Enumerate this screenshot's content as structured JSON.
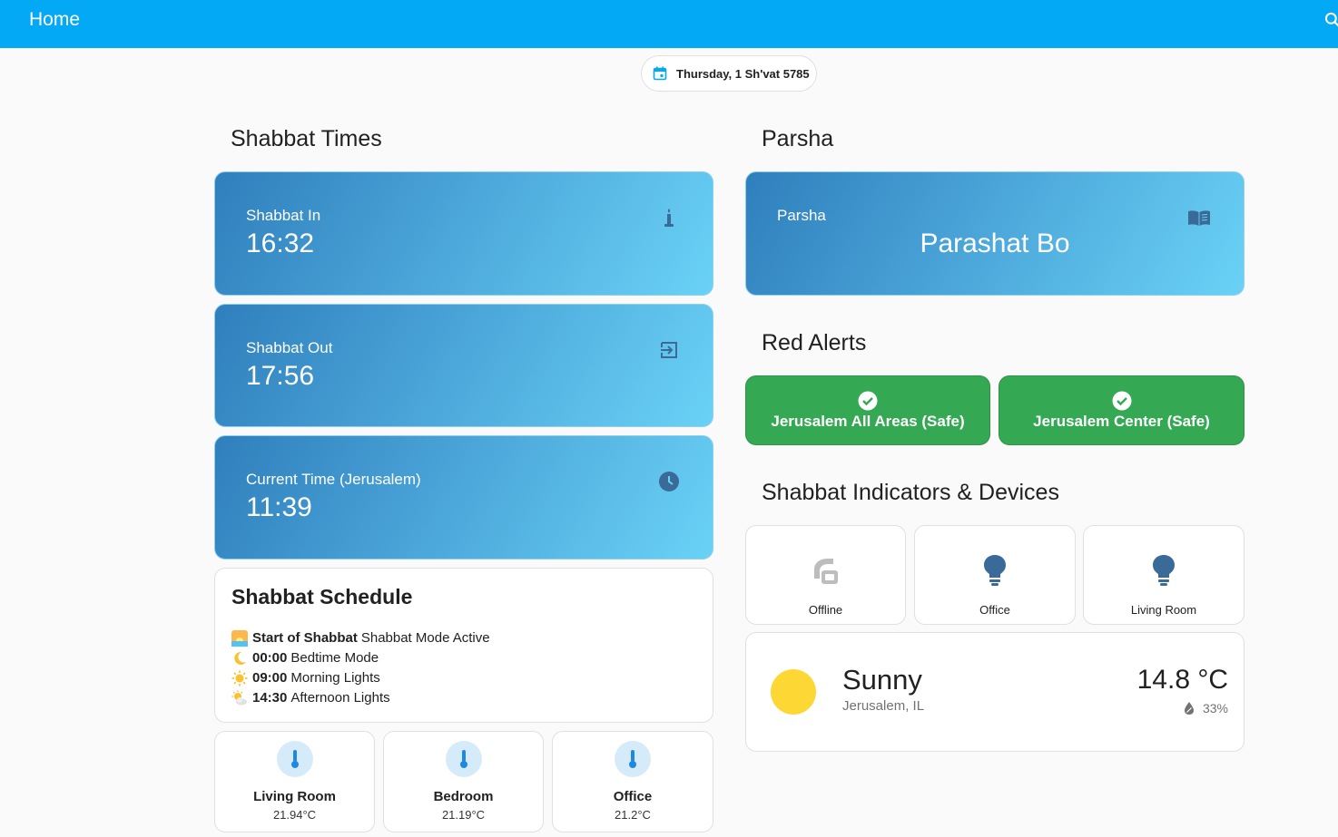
{
  "header": {
    "title": "Home",
    "search_icon": "search-icon"
  },
  "date_chip": {
    "icon": "calendar-icon",
    "text": "Thursday, 1 Sh'vat 5785"
  },
  "shabbat_times": {
    "title": "Shabbat Times",
    "cards": [
      {
        "label": "Shabbat In",
        "value": "16:32",
        "icon": "candle-icon"
      },
      {
        "label": "Shabbat Out",
        "value": "17:56",
        "icon": "exit-icon"
      },
      {
        "label": "Current Time (Jerusalem)",
        "value": "11:39",
        "icon": "clock-icon"
      }
    ]
  },
  "schedule": {
    "title": "Shabbat Schedule",
    "rows": [
      {
        "icon": "sunrise-icon",
        "time": "Start of Shabbat",
        "text": "Shabbat Mode Active"
      },
      {
        "icon": "moon-icon",
        "time": "00:00",
        "text": "Bedtime Mode"
      },
      {
        "icon": "sun-icon",
        "time": "09:00",
        "text": "Morning Lights"
      },
      {
        "icon": "sun-cloud-icon",
        "time": "14:30",
        "text": "Afternoon Lights"
      }
    ]
  },
  "temperatures": [
    {
      "name": "Living Room",
      "value": "21.94°C",
      "icon": "thermometer-icon"
    },
    {
      "name": "Bedroom",
      "value": "21.19°C",
      "icon": "thermometer-icon"
    },
    {
      "name": "Office",
      "value": "21.2°C",
      "icon": "thermometer-icon"
    }
  ],
  "parsha": {
    "title": "Parsha",
    "card": {
      "label": "Parsha",
      "value": "Parashat Bo",
      "icon": "book-open-icon"
    }
  },
  "red_alerts": {
    "title": "Red Alerts",
    "items": [
      {
        "text": "Jerusalem All Areas (Safe)",
        "icon": "check-circle-icon"
      },
      {
        "text": "Jerusalem Center (Safe)",
        "icon": "check-circle-icon"
      }
    ],
    "color": "#34a853"
  },
  "devices": {
    "title": "Shabbat Indicators & Devices",
    "items": [
      {
        "name": "Offline",
        "icon": "stove-icon"
      },
      {
        "name": "Office",
        "icon": "lightbulb-icon"
      },
      {
        "name": "Living Room",
        "icon": "lightbulb-icon"
      }
    ]
  },
  "weather": {
    "condition": "Sunny",
    "location": "Jerusalem, IL",
    "temperature": "14.8 °C",
    "humidity": "33%",
    "icon": "sun-icon"
  },
  "colors": {
    "header": "#03a9f4",
    "card_gradient_start": "#2f7fbc",
    "card_gradient_end": "#6ad2f6",
    "icon_dark": "#3a6b98"
  }
}
